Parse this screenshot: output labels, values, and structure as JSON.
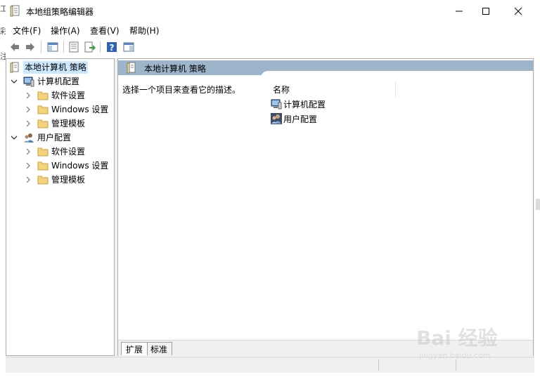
{
  "window": {
    "title": "本地组策略编辑器"
  },
  "edge": {
    "left_marks": [
      "工",
      "彩",
      "注"
    ]
  },
  "menubar": {
    "items": [
      {
        "label": "文件(F)"
      },
      {
        "label": "操作(A)"
      },
      {
        "label": "查看(V)"
      },
      {
        "label": "帮助(H)"
      }
    ]
  },
  "toolbar": {
    "buttons": [
      {
        "icon": "back-arrow-icon"
      },
      {
        "icon": "forward-arrow-icon"
      },
      {
        "icon": "show-hide-console-tree-icon"
      },
      {
        "icon": "properties-icon"
      },
      {
        "icon": "export-list-icon"
      },
      {
        "icon": "help-icon"
      },
      {
        "icon": "show-hide-action-pane-icon"
      }
    ]
  },
  "tree": {
    "root": "本地计算机 策略",
    "groups": [
      {
        "label": "计算机配置",
        "children": [
          "软件设置",
          "Windows 设置",
          "管理模板"
        ]
      },
      {
        "label": "用户配置",
        "children": [
          "软件设置",
          "Windows 设置",
          "管理模板"
        ]
      }
    ]
  },
  "detail": {
    "header": "本地计算机 策略",
    "description": "选择一个项目来查看它的描述。",
    "column_name": "名称",
    "items": [
      {
        "label": "计算机配置"
      },
      {
        "label": "用户配置"
      }
    ]
  },
  "tabs": [
    {
      "label": "扩展"
    },
    {
      "label": "标准"
    }
  ],
  "watermark": {
    "brand": "Bai 经验",
    "url": "jingyan.baidu.com"
  },
  "colors": {
    "header_band": "#9db5cb",
    "selection": "#cce8ff",
    "folder": "#e8c15a"
  }
}
